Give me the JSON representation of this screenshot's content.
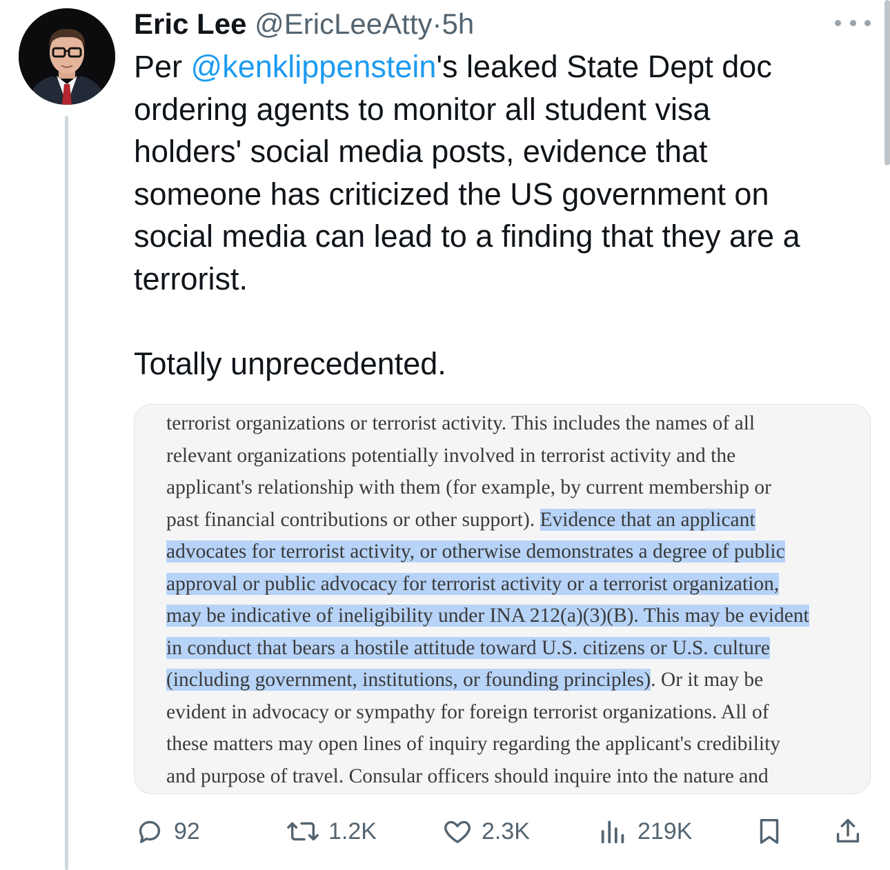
{
  "tweet": {
    "author_name": "Eric Lee",
    "author_handle": "@EricLeeAtty",
    "separator": "·",
    "timestamp": "5h",
    "text": {
      "line1_prefix": "Per ",
      "line1_mention": "@kenklippenstein",
      "line1_suffix": "'s leaked State Dept doc",
      "line2": "ordering agents to monitor all student visa",
      "line3": "holders' social media posts, evidence that",
      "line4": "someone has criticized the US government on",
      "line5": "social media can lead to a finding that they are a",
      "line6": "terrorist.",
      "line7": "Totally unprecedented."
    }
  },
  "document_image": {
    "lines": [
      {
        "plain": "terrorist organizations or terrorist activity. This includes the names of all"
      },
      {
        "plain": "relevant organizations potentially involved in terrorist activity and the"
      },
      {
        "plain": "applicant's relationship with them (for example, by current membership or"
      },
      {
        "plain": "past financial contributions or other support). ",
        "highlight": "Evidence that an applicant"
      },
      {
        "highlight": "advocates for terrorist activity, or otherwise demonstrates a degree of public"
      },
      {
        "highlight": "approval or public advocacy for terrorist activity or a terrorist organization,"
      },
      {
        "highlight": "may be indicative of ineligibility under INA 212(a)(3)(B). This may be evident"
      },
      {
        "highlight": "in conduct that bears a hostile attitude toward U.S. citizens or U.S. culture"
      },
      {
        "highlight": "(including government, institutions, or founding principles)",
        "plain_after": ". Or it may be"
      },
      {
        "plain": "evident in advocacy or sympathy for foreign terrorist organizations. All of"
      },
      {
        "plain": "these matters may open lines of inquiry regarding the applicant's credibility"
      },
      {
        "plain": "and purpose of travel. Consular officers should inquire into the nature and"
      }
    ]
  },
  "actions": {
    "replies": "92",
    "reposts": "1.2K",
    "likes": "2.3K",
    "views": "219K"
  },
  "icons": {
    "reply": "reply-icon",
    "repost": "repost-icon",
    "like": "heart-icon",
    "views": "views-icon",
    "bookmark": "bookmark-icon",
    "share": "share-icon",
    "more": "more-dots-icon"
  },
  "colors": {
    "link": "#1d9bf0",
    "secondary_text": "#536471",
    "highlight": "#b7d3f7"
  }
}
